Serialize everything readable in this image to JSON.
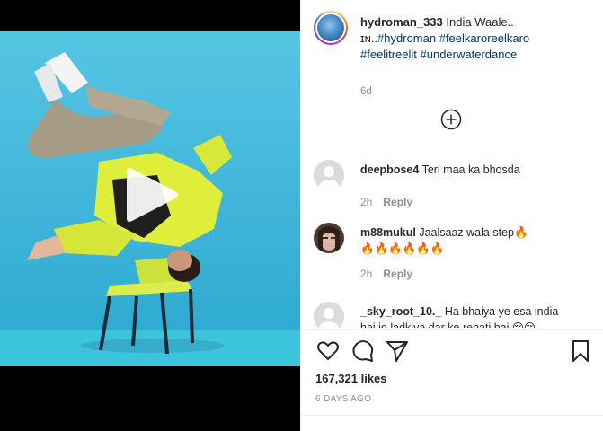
{
  "post": {
    "username": "hydroman_333",
    "caption_text": "India Waale..",
    "caption_line2_prefix": "ɪɴ..",
    "hashtags_line2": [
      "#hydroman",
      "#feelkaroreelkaro"
    ],
    "hashtags_line3": [
      "#feelitreelit",
      "#underwaterdance"
    ],
    "age": "6d",
    "likes": "167,321 likes",
    "posted": "6 DAYS AGO"
  },
  "comments": [
    {
      "username": "deepbose4",
      "text": "Teri maa ka bhosda",
      "age": "2h",
      "reply_label": "Reply"
    },
    {
      "username": "m88mukul",
      "text": "Jaalsaaz wala step🔥🔥🔥🔥🔥🔥🔥",
      "age": "2h",
      "reply_label": "Reply"
    },
    {
      "username": "_sky_root_10._",
      "text": "Ha bhaiya ye esa india hai jo ladkiya dar ke rehati hai 😔😔",
      "age": "",
      "reply_label": ""
    }
  ],
  "icons": {
    "play": "play-icon",
    "load_more": "plus-circle-icon",
    "like": "heart-icon",
    "comment": "comment-bubble-icon",
    "share": "paper-plane-icon",
    "save": "bookmark-icon"
  },
  "colors": {
    "hashtag": "#00376b",
    "muted": "#8e8e8e",
    "water": "#3fb8d9",
    "jacket": "#e3f03a"
  }
}
